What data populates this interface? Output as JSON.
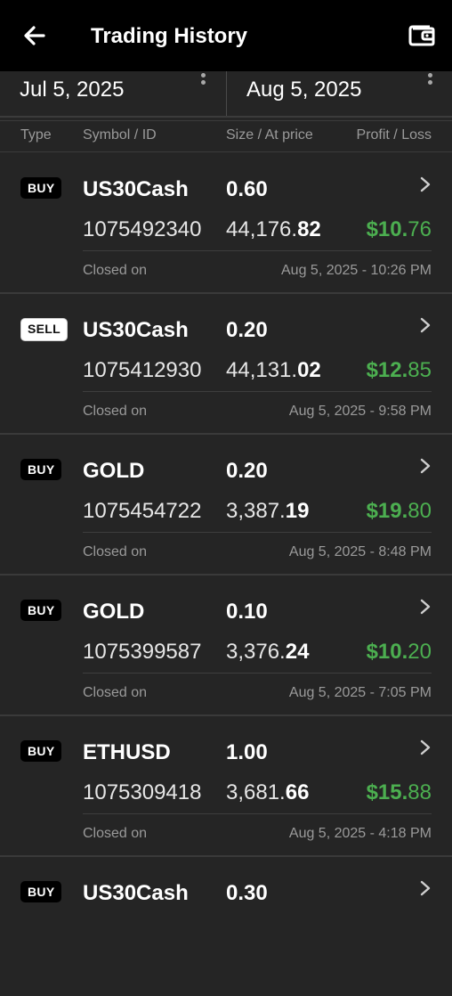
{
  "header": {
    "title": "Trading History",
    "back_icon": "arrow-left-icon",
    "wallet_icon": "wallet-icon"
  },
  "date_range": {
    "start": "Jul 5, 2025",
    "end": "Aug 5, 2025"
  },
  "columns": {
    "type": "Type",
    "symbol_id": "Symbol / ID",
    "size_price": "Size / At price",
    "profit_loss": "Profit / Loss"
  },
  "closed_label": "Closed on",
  "colors": {
    "profit": "#4caf50",
    "header_bg": "#000000",
    "page_bg": "#252525"
  },
  "trades": [
    {
      "type": "BUY",
      "symbol": "US30Cash",
      "size": "0.60",
      "id": "1075492340",
      "price_main": "44,176.",
      "price_dec": "82",
      "pl_main": "$10.",
      "pl_dec": "76",
      "closed": "Aug 5, 2025 - 10:26 PM"
    },
    {
      "type": "SELL",
      "symbol": "US30Cash",
      "size": "0.20",
      "id": "1075412930",
      "price_main": "44,131.",
      "price_dec": "02",
      "pl_main": "$12.",
      "pl_dec": "85",
      "closed": "Aug 5, 2025 - 9:58 PM"
    },
    {
      "type": "BUY",
      "symbol": "GOLD",
      "size": "0.20",
      "id": "1075454722",
      "price_main": "3,387.",
      "price_dec": "19",
      "pl_main": "$19.",
      "pl_dec": "80",
      "closed": "Aug 5, 2025 - 8:48 PM"
    },
    {
      "type": "BUY",
      "symbol": "GOLD",
      "size": "0.10",
      "id": "1075399587",
      "price_main": "3,376.",
      "price_dec": "24",
      "pl_main": "$10.",
      "pl_dec": "20",
      "closed": "Aug 5, 2025 - 7:05 PM"
    },
    {
      "type": "BUY",
      "symbol": "ETHUSD",
      "size": "1.00",
      "id": "1075309418",
      "price_main": "3,681.",
      "price_dec": "66",
      "pl_main": "$15.",
      "pl_dec": "88",
      "closed": "Aug 5, 2025 - 4:18 PM"
    },
    {
      "type": "BUY",
      "symbol": "US30Cash",
      "size": "0.30"
    }
  ]
}
